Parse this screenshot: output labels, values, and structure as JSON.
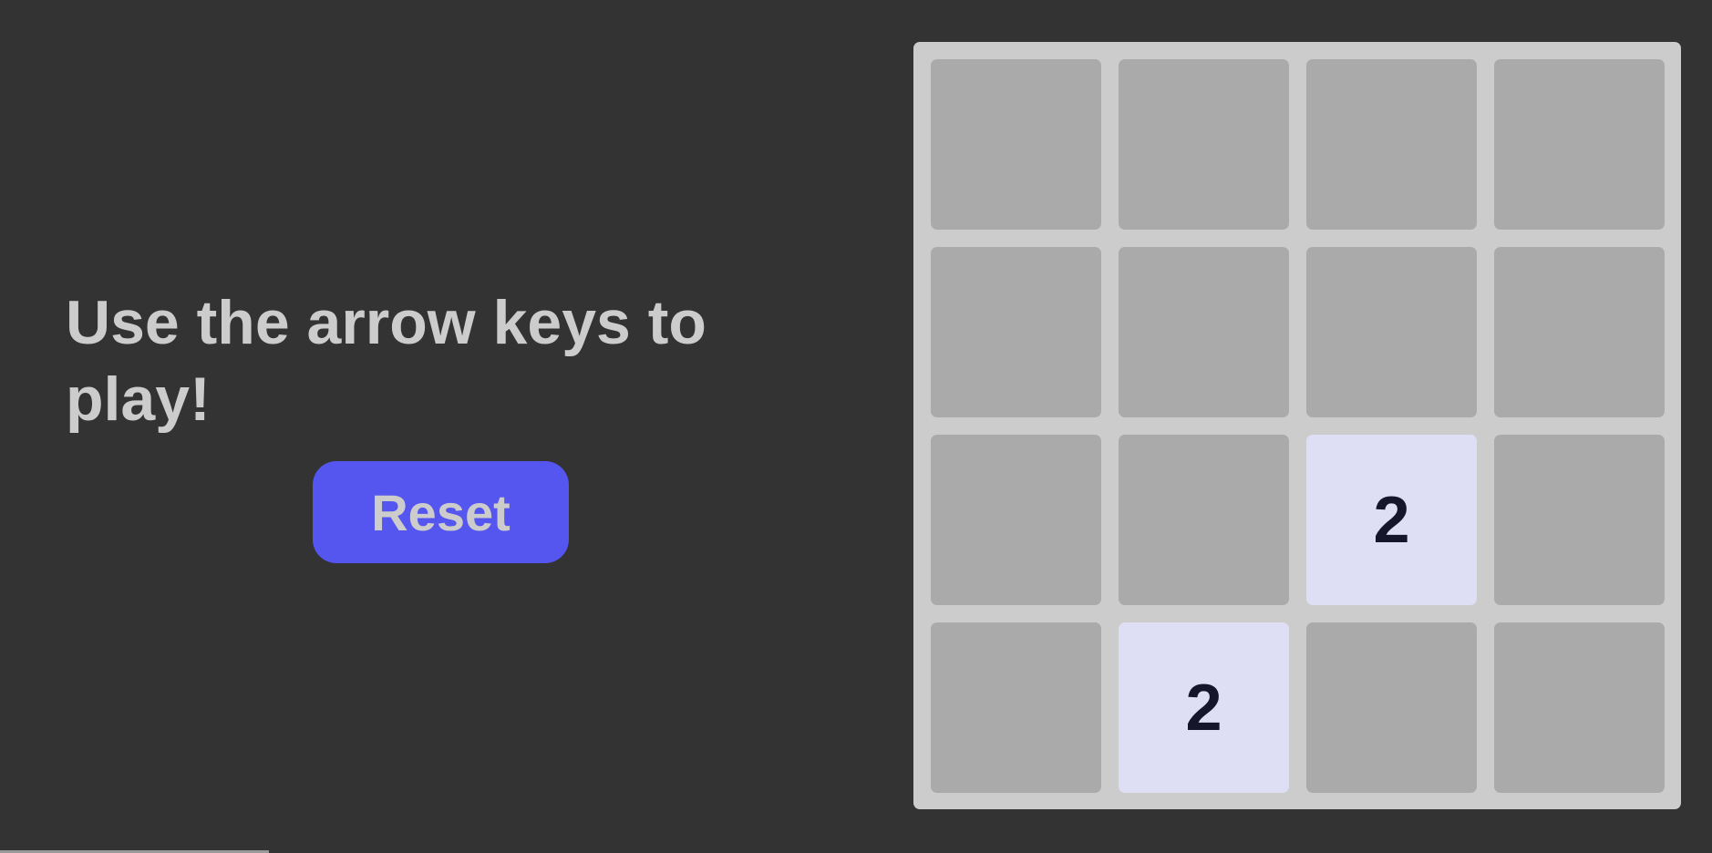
{
  "instructions": {
    "text": "Use the arrow keys to play!"
  },
  "controls": {
    "reset_label": "Reset"
  },
  "board": {
    "rows": [
      [
        "",
        "",
        "",
        ""
      ],
      [
        "",
        "",
        "",
        ""
      ],
      [
        "",
        "",
        "2",
        ""
      ],
      [
        "",
        "2",
        "",
        ""
      ]
    ]
  },
  "colors": {
    "background": "#333333",
    "board": "#cccccc",
    "empty_tile": "#aaaaaa",
    "tile_2": "#dedef5",
    "reset_button": "#5555f0",
    "text_light": "#cccccc",
    "text_dark": "#16162a"
  }
}
